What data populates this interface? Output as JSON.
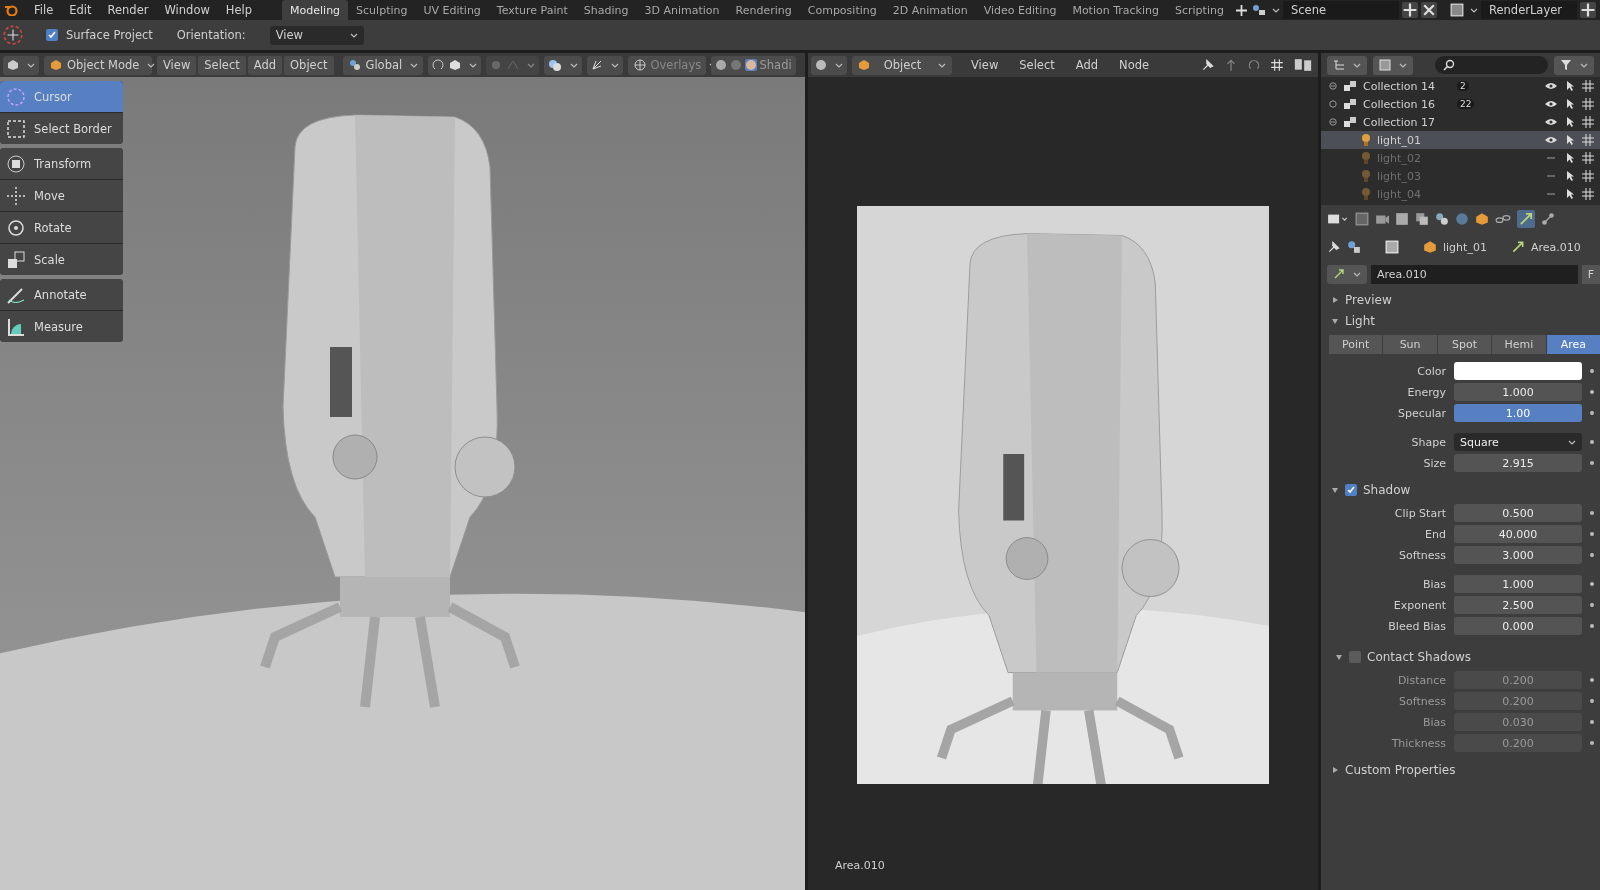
{
  "menu": [
    "File",
    "Edit",
    "Render",
    "Window",
    "Help"
  ],
  "workspaces": [
    {
      "label": "Modeling",
      "selected": true
    },
    {
      "label": "Sculpting",
      "selected": false
    },
    {
      "label": "UV Editing",
      "selected": false
    },
    {
      "label": "Texture Paint",
      "selected": false
    },
    {
      "label": "Shading",
      "selected": false
    },
    {
      "label": "3D Animation",
      "selected": false
    },
    {
      "label": "Rendering",
      "selected": false
    },
    {
      "label": "Compositing",
      "selected": false
    },
    {
      "label": "2D Animation",
      "selected": false
    },
    {
      "label": "Video Editing",
      "selected": false
    },
    {
      "label": "Motion Tracking",
      "selected": false
    },
    {
      "label": "Scripting",
      "selected": false
    }
  ],
  "scene": {
    "name": "Scene"
  },
  "view_layer": {
    "name": "RenderLayer"
  },
  "tool_settings": {
    "surface_project": {
      "label": "Surface Project",
      "checked": true
    },
    "orientation": {
      "label": "Orientation:",
      "value": "View"
    }
  },
  "viewport": {
    "mode": "Object Mode",
    "menus": [
      "View",
      "Select",
      "Add",
      "Object"
    ],
    "orientation": "Global",
    "overlays": "Overlays",
    "shading": "Shadi",
    "tool_groups": [
      [
        {
          "label": "Cursor",
          "selected": true
        },
        {
          "label": "Select Border",
          "selected": false
        }
      ],
      [
        {
          "label": "Transform",
          "selected": false
        },
        {
          "label": "Move",
          "selected": false
        },
        {
          "label": "Rotate",
          "selected": false
        },
        {
          "label": "Scale",
          "selected": false
        }
      ],
      [
        {
          "label": "Annotate",
          "selected": false
        },
        {
          "label": "Measure",
          "selected": false
        }
      ]
    ]
  },
  "image_editor": {
    "mode": "Object",
    "menus": [
      "View",
      "Select",
      "Add",
      "Node"
    ],
    "caption": "Area.010"
  },
  "outliner": {
    "rows": [
      {
        "name": "Collection 14",
        "kind": "collection",
        "expanded": true,
        "visible": true,
        "selected": false,
        "count": "2"
      },
      {
        "name": "Collection 16",
        "kind": "collection",
        "expanded": false,
        "visible": true,
        "selected": false,
        "count": "22"
      },
      {
        "name": "Collection 17",
        "kind": "collection",
        "expanded": true,
        "visible": true,
        "selected": false,
        "children": [
          {
            "name": "light_01",
            "kind": "light",
            "visible": true,
            "selected": true
          },
          {
            "name": "light_02",
            "kind": "light",
            "visible": false,
            "selected": false
          },
          {
            "name": "light_03",
            "kind": "light",
            "visible": false,
            "selected": false
          },
          {
            "name": "light_04",
            "kind": "light",
            "visible": false,
            "selected": false
          }
        ]
      }
    ]
  },
  "properties": {
    "context": [
      "light_01",
      "Area.010"
    ],
    "datablock": "Area.010",
    "fake_user": "F",
    "panels": [
      {
        "title": "Preview",
        "expanded": false
      },
      {
        "title": "Light",
        "expanded": true,
        "types": [
          {
            "label": "Point",
            "selected": false
          },
          {
            "label": "Sun",
            "selected": false
          },
          {
            "label": "Spot",
            "selected": false
          },
          {
            "label": "Hemi",
            "selected": false
          },
          {
            "label": "Area",
            "selected": true
          }
        ],
        "groups": [
          [
            {
              "label": "Color",
              "kind": "color",
              "color": "#ffffff"
            },
            {
              "label": "Energy",
              "kind": "number",
              "value": "1.000"
            },
            {
              "label": "Specular",
              "kind": "slider",
              "value": "1.00",
              "level": 1
            }
          ],
          [
            {
              "label": "Shape",
              "kind": "dropdown",
              "value": "Square"
            },
            {
              "label": "Size",
              "kind": "number",
              "value": "2.915"
            }
          ]
        ]
      },
      {
        "title": "Shadow",
        "expanded": true,
        "checked": true,
        "groups": [
          [
            {
              "label": "Clip Start",
              "kind": "number",
              "value": "0.500"
            },
            {
              "label": "End",
              "kind": "number",
              "value": "40.000"
            },
            {
              "label": "Softness",
              "kind": "number",
              "value": "3.000"
            }
          ],
          [
            {
              "label": "Bias",
              "kind": "number",
              "value": "1.000"
            },
            {
              "label": "Exponent",
              "kind": "number",
              "value": "2.500"
            },
            {
              "label": "Bleed Bias",
              "kind": "number",
              "value": "0.000"
            }
          ]
        ]
      },
      {
        "title": "Contact Shadows",
        "expanded": true,
        "checked": false,
        "groups": [
          [
            {
              "label": "Distance",
              "kind": "number",
              "value": "0.200"
            },
            {
              "label": "Softness",
              "kind": "number",
              "value": "0.200"
            },
            {
              "label": "Bias",
              "kind": "number",
              "value": "0.030"
            },
            {
              "label": "Thickness",
              "kind": "number",
              "value": "0.200"
            }
          ]
        ]
      },
      {
        "title": "Custom Properties",
        "expanded": false
      }
    ]
  }
}
